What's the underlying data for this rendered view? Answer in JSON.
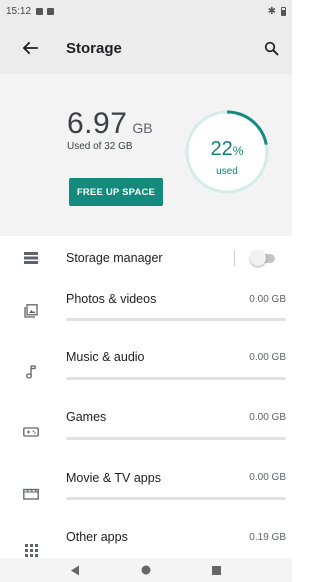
{
  "status_bar": {
    "time": "15:12",
    "bluetooth_icon": "bluetooth-icon",
    "battery_icon": "battery-icon"
  },
  "app_bar": {
    "title": "Storage",
    "back_icon": "arrow-back-icon",
    "search_icon": "search-icon"
  },
  "summary": {
    "used_value": "6.97",
    "used_unit": "GB",
    "used_of": "Used of 32 GB",
    "free_button": "FREE UP SPACE",
    "percent_number": "22",
    "percent_sign": "%",
    "percent_caption": "used",
    "percent_used_fraction": 0.22
  },
  "storage_manager": {
    "label": "Storage manager",
    "enabled": false,
    "icon": "storage-manager-icon"
  },
  "categories": [
    {
      "label": "Photos & videos",
      "size": "0.00 GB",
      "icon": "photos-icon",
      "fill_fraction": 0.0
    },
    {
      "label": "Music & audio",
      "size": "0.00 GB",
      "icon": "music-note-icon",
      "fill_fraction": 0.0
    },
    {
      "label": "Games",
      "size": "0.00 GB",
      "icon": "gamepad-icon",
      "fill_fraction": 0.0
    },
    {
      "label": "Movie & TV apps",
      "size": "0.00 GB",
      "icon": "movie-icon",
      "fill_fraction": 0.0
    },
    {
      "label": "Other apps",
      "size": "0.19 GB",
      "icon": "apps-grid-icon",
      "fill_fraction": 0.03
    }
  ],
  "colors": {
    "accent": "#138a7b",
    "ring_track": "#d6ece8",
    "app_bar": "#ececec"
  }
}
